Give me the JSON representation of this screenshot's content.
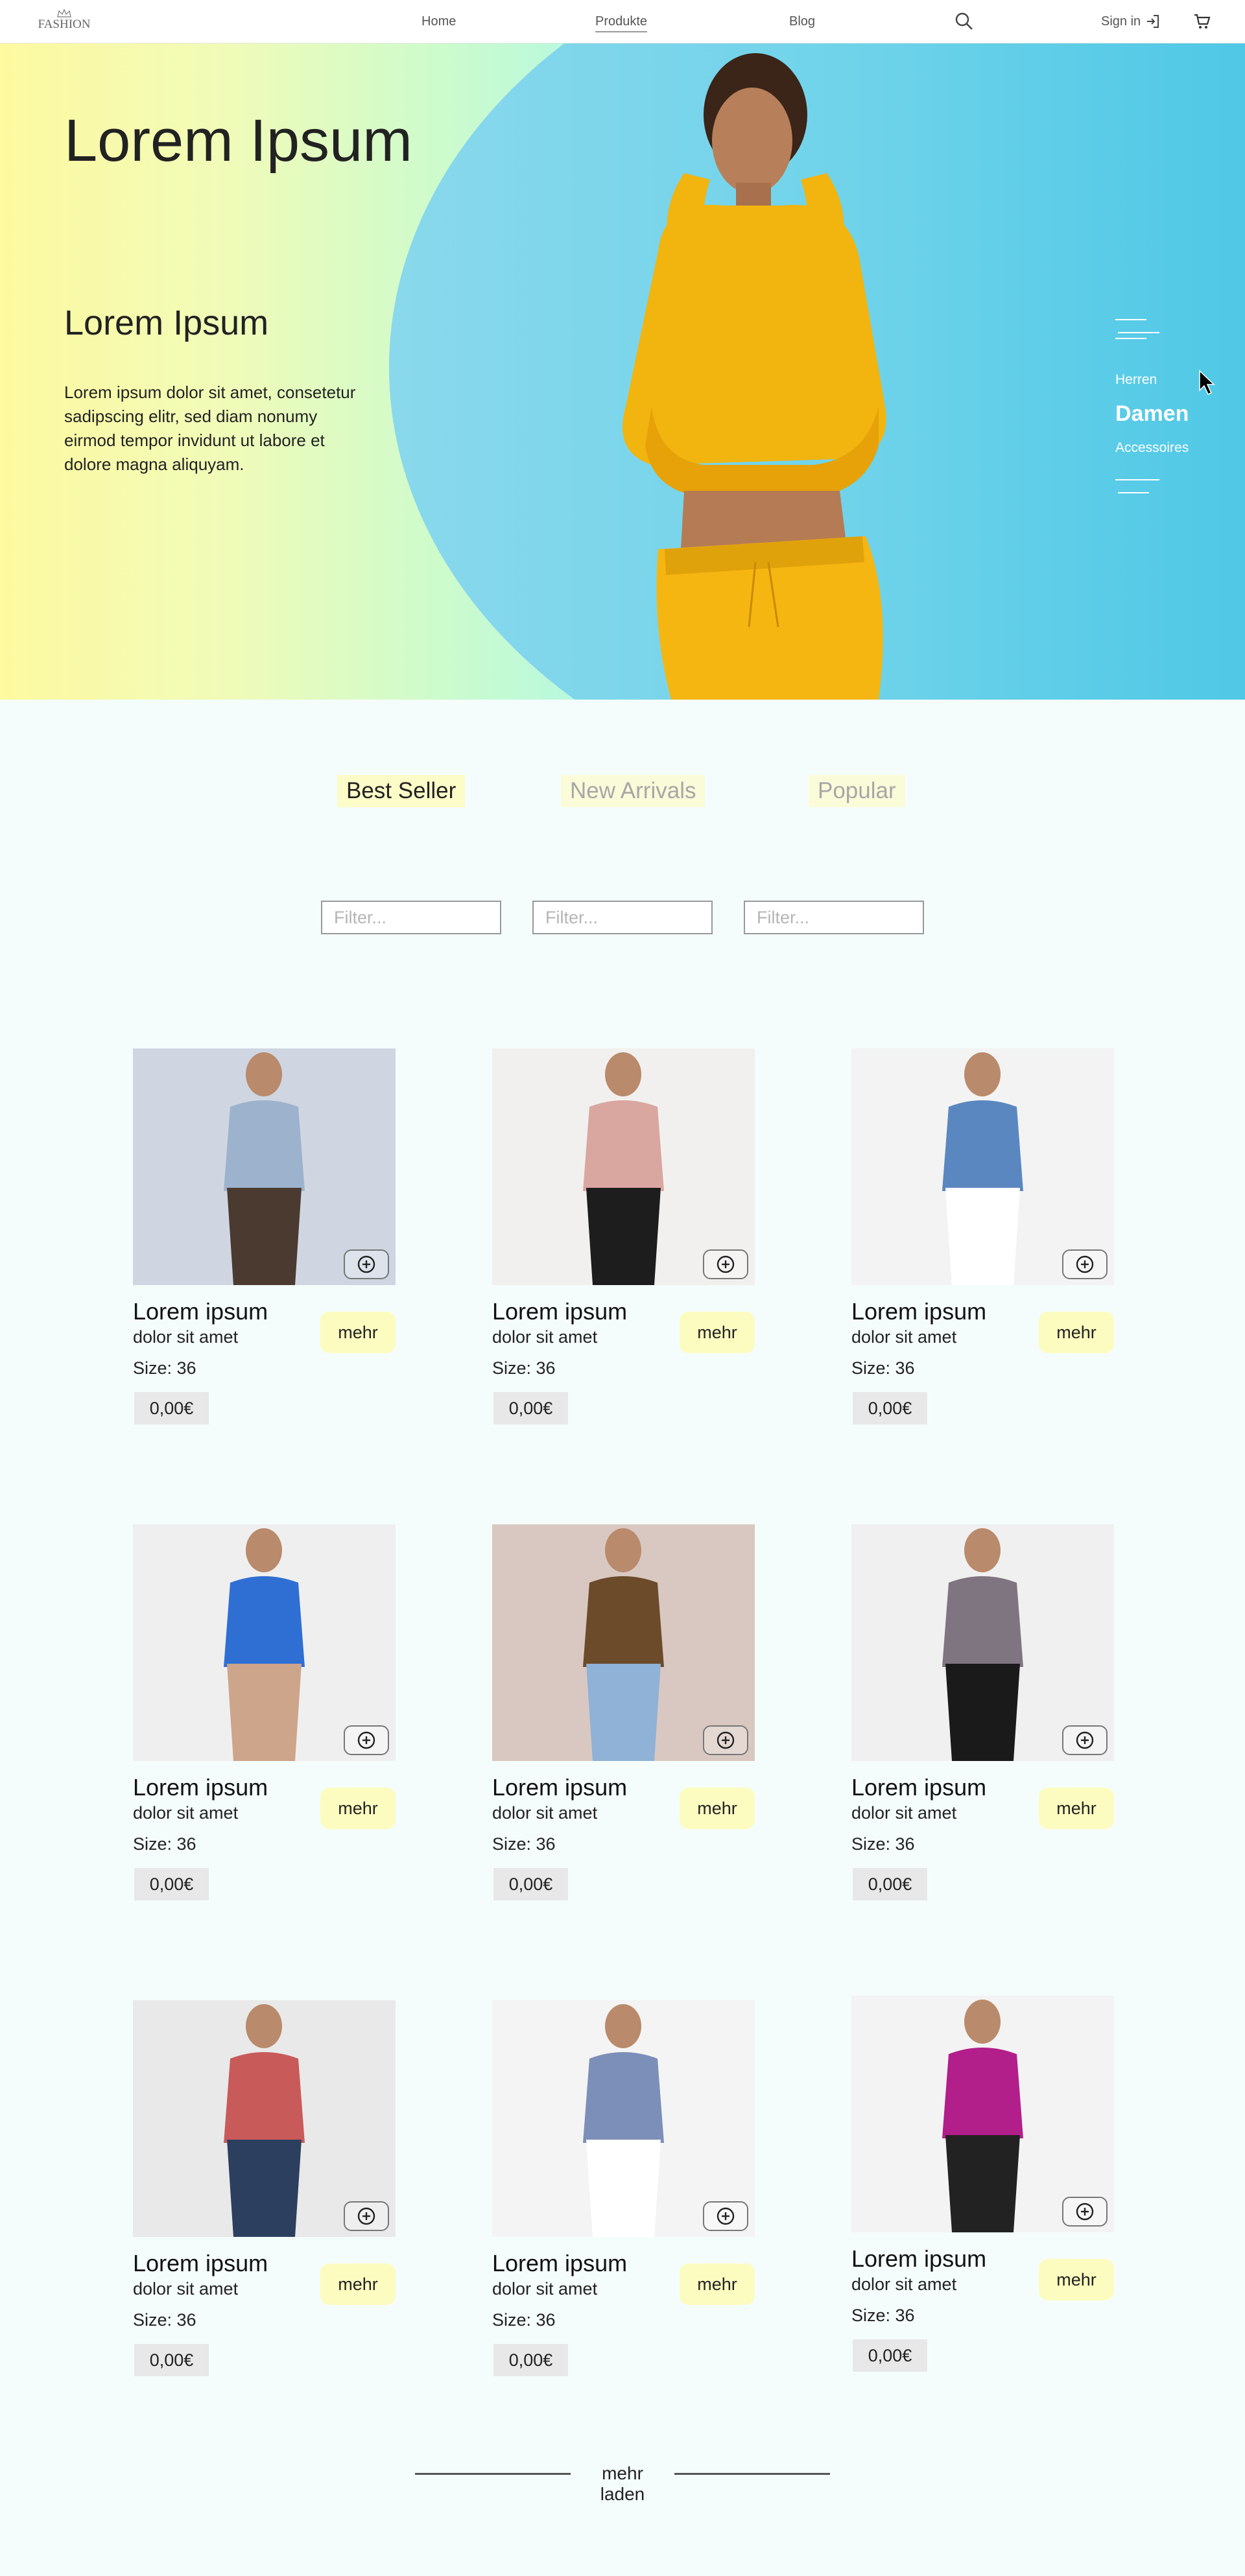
{
  "nav": {
    "logo": "FASHION",
    "items": [
      "Home",
      "Produkte",
      "Blog"
    ],
    "signin": "Sign in"
  },
  "hero": {
    "title": "Lorem Ipsum",
    "subtitle": "Lorem Ipsum",
    "text": "Lorem ipsum dolor sit amet, consetetur sadipscing elitr, sed diam nonumy eirmod tempor invidunt ut labore et dolore magna aliquyam.",
    "menu": [
      "Herren",
      "Damen",
      "Accessoires"
    ]
  },
  "tabs": [
    "Best Seller",
    "New Arrivals",
    "Popular"
  ],
  "filter_placeholder": "Filter...",
  "products": [
    {
      "title": "Lorem ipsum",
      "sub": "dolor sit amet",
      "size": "Size: 36",
      "price": "0,00€",
      "more": "mehr"
    },
    {
      "title": "Lorem ipsum",
      "sub": "dolor sit amet",
      "size": "Size: 36",
      "price": "0,00€",
      "more": "mehr"
    },
    {
      "title": "Lorem ipsum",
      "sub": "dolor sit amet",
      "size": "Size: 36",
      "price": "0,00€",
      "more": "mehr"
    },
    {
      "title": "Lorem ipsum",
      "sub": "dolor sit amet",
      "size": "Size: 36",
      "price": "0,00€",
      "more": "mehr"
    },
    {
      "title": "Lorem ipsum",
      "sub": "dolor sit amet",
      "size": "Size: 36",
      "price": "0,00€",
      "more": "mehr"
    },
    {
      "title": "Lorem ipsum",
      "sub": "dolor sit amet",
      "size": "Size: 36",
      "price": "0,00€",
      "more": "mehr"
    },
    {
      "title": "Lorem ipsum",
      "sub": "dolor sit amet",
      "size": "Size: 36",
      "price": "0,00€",
      "more": "mehr"
    },
    {
      "title": "Lorem ipsum",
      "sub": "dolor sit amet",
      "size": "Size: 36",
      "price": "0,00€",
      "more": "mehr"
    },
    {
      "title": "Lorem ipsum",
      "sub": "dolor sit amet",
      "size": "Size: 36",
      "price": "0,00€",
      "more": "mehr"
    }
  ],
  "load_more": "mehr laden"
}
